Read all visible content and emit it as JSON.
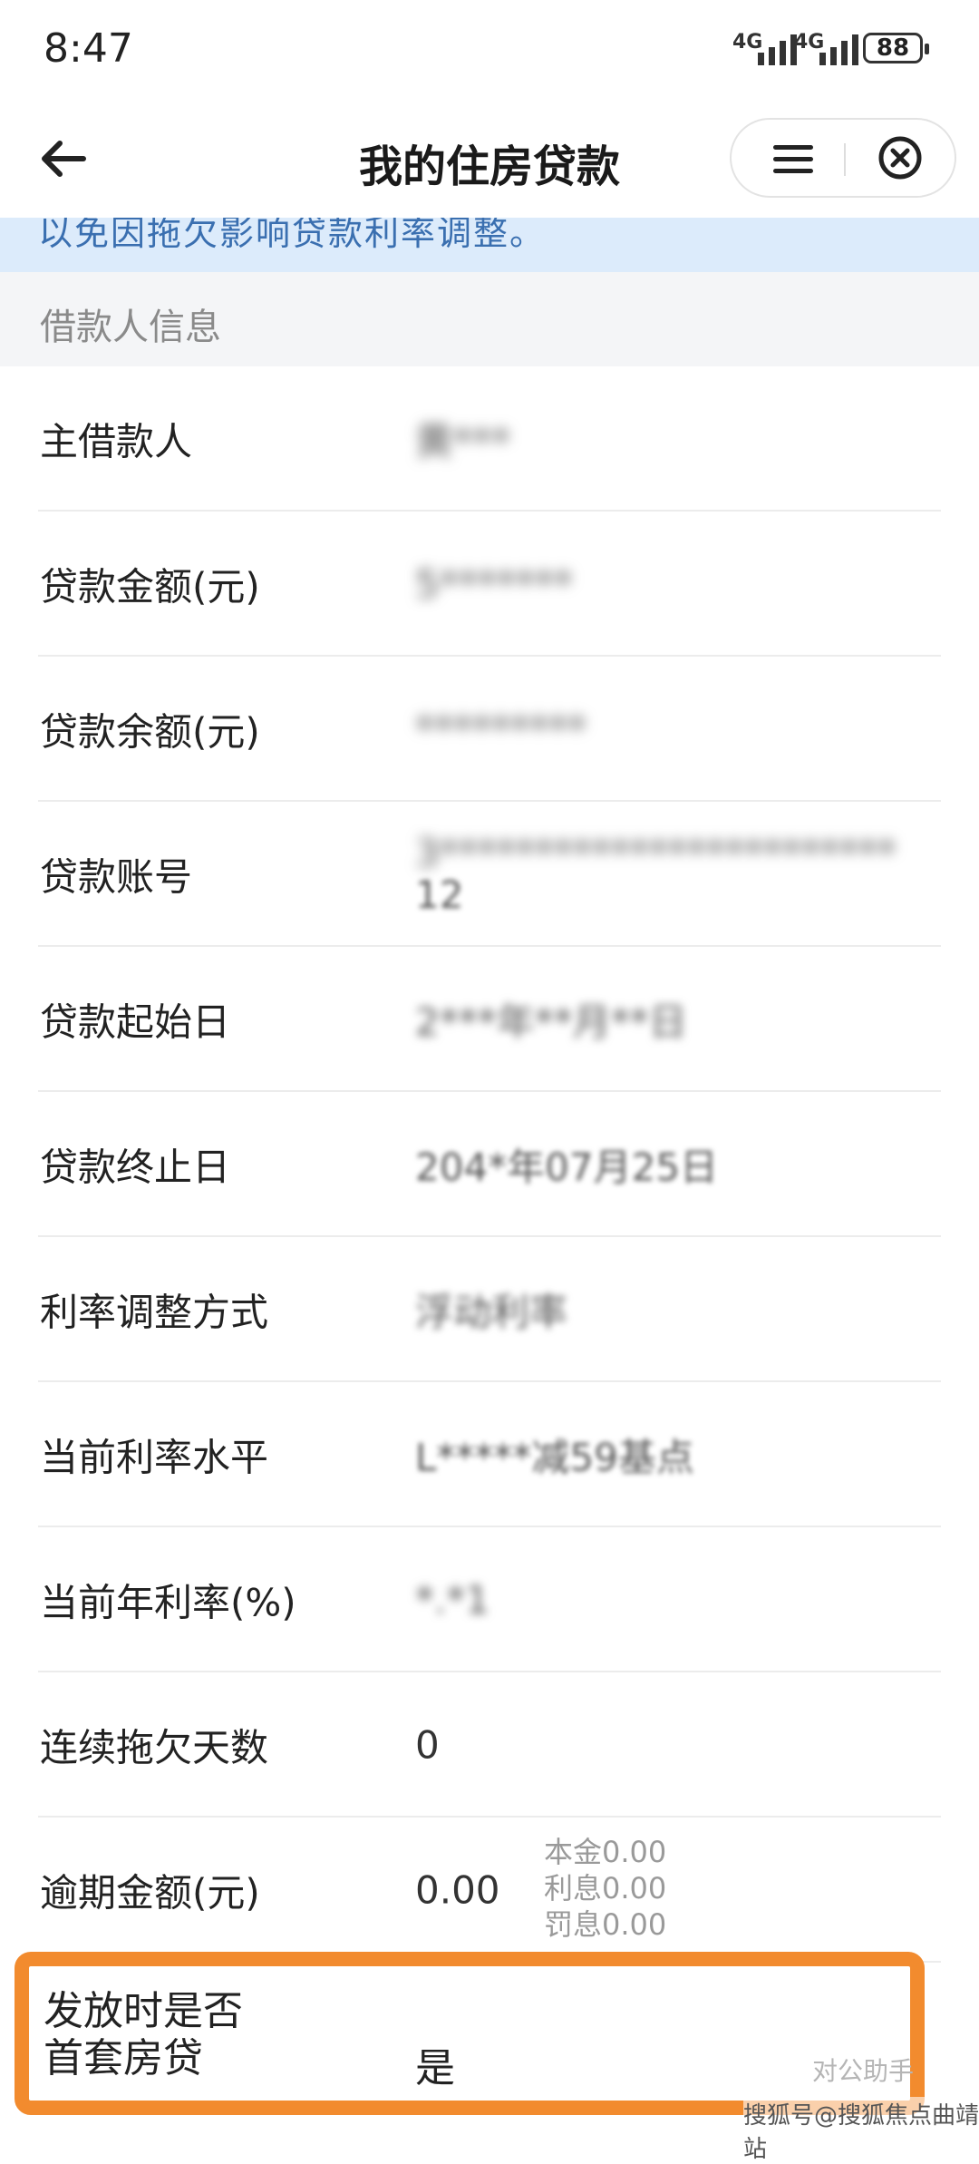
{
  "status_bar": {
    "time": "8:47",
    "net1": "4G",
    "net2": "4G",
    "battery": "88"
  },
  "header": {
    "title": "我的住房贷款"
  },
  "notice": {
    "text": "以免因拖欠影响贷款利率调整。"
  },
  "section": {
    "title": "借款人信息"
  },
  "rows": [
    {
      "label": "主借款人",
      "value": "黄***"
    },
    {
      "label": "贷款金额(元)",
      "value": "5*******"
    },
    {
      "label": "贷款余额(元)",
      "value": "*********"
    },
    {
      "label": "贷款账号",
      "value": "3************************",
      "value2": "12"
    },
    {
      "label": "贷款起始日",
      "value": "2***年**月**日"
    },
    {
      "label": "贷款终止日",
      "value": "204*年07月25日"
    },
    {
      "label": "利率调整方式",
      "value": "浮动利率"
    },
    {
      "label": "当前利率水平",
      "value": "L*****减59基点"
    },
    {
      "label": "当前年利率(%)",
      "value": "*.*1"
    },
    {
      "label": "连续拖欠天数",
      "value": "0"
    },
    {
      "label": "逾期金额(元)",
      "value": "0.00",
      "sub": [
        "本金0.00",
        "利息0.00",
        "罚息0.00"
      ]
    }
  ],
  "last_row": {
    "label_line1": "发放时是否",
    "label_line2": "首套房贷",
    "value": "是"
  },
  "watermark": {
    "line1": "对公助手",
    "line2": "搜狐号@搜狐焦点曲靖站"
  },
  "colors": {
    "highlight": "#f28b2e",
    "notice_bg": "#dcebfb",
    "notice_text": "#3a6fb0"
  }
}
